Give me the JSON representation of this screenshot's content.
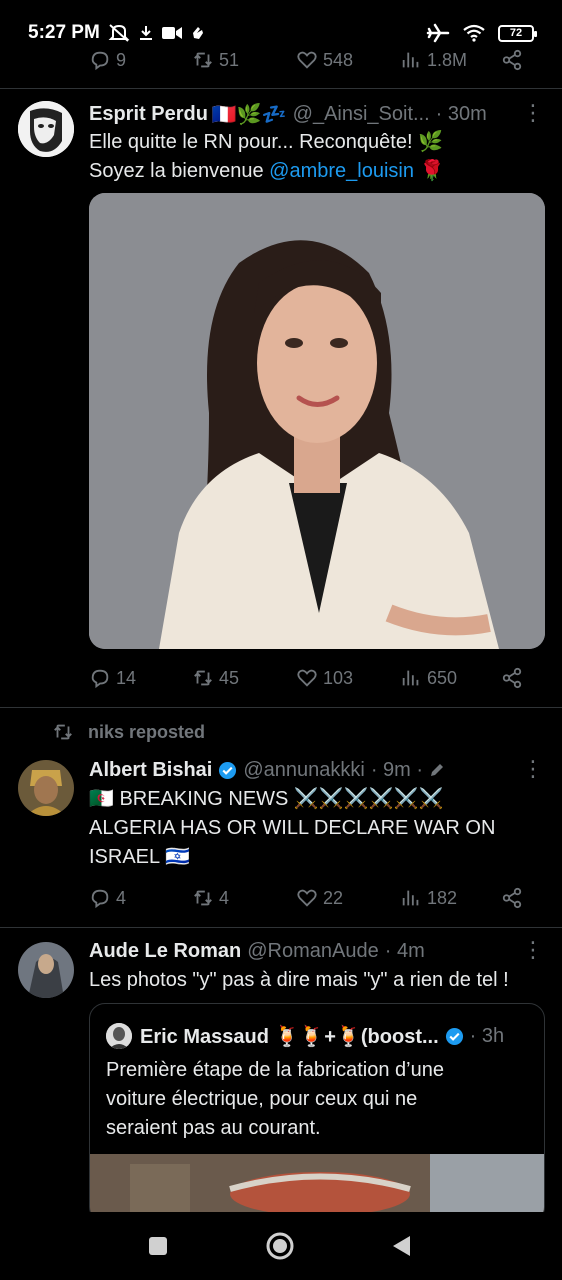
{
  "status_bar": {
    "time": "5:27 PM",
    "battery": "72",
    "icons": [
      "mute-icon",
      "download-icon",
      "video-icon",
      "hand-icon",
      "airplane-icon",
      "wifi-icon",
      "battery-icon"
    ]
  },
  "top_actions": {
    "replies": "9",
    "reposts": "51",
    "likes": "548",
    "views": "1.8M"
  },
  "tweet1": {
    "name": "Esprit Perdu",
    "name_emoji": "🇫🇷🌿💤",
    "handle": "@_Ainsi_Soit...",
    "time": "· 30m",
    "text_line1": "Elle quitte le RN pour... Reconquête! 🌿",
    "text_line2_prefix": "Soyez la bienvenue ",
    "mention": "@ambre_louisin",
    "text_line2_suffix": " 🌹",
    "replies": "14",
    "reposts": "45",
    "likes": "103",
    "views": "650"
  },
  "tweet2": {
    "repost_label": "niks reposted",
    "name": "Albert Bishai",
    "handle": "@annunakkki",
    "time": "· 9m ·",
    "line1": "🇩🇿 BREAKING NEWS ⚔️⚔️⚔️⚔️⚔️⚔️",
    "line2": "ALGERIA HAS OR WILL DECLARE WAR ON",
    "line3": "ISRAEL 🇮🇱",
    "replies": "4",
    "reposts": "4",
    "likes": "22",
    "views": "182"
  },
  "tweet3": {
    "name": "Aude Le Roman",
    "handle": "@RomanAude",
    "time": "· 4m",
    "text": "Les photos \"y\" pas à dire mais \"y\" a rien de tel !",
    "quote": {
      "name": "Eric Massaud 🍹🍹+🍹(boost...",
      "time": "· 3h",
      "line1": "Première étape de la fabrication d’une",
      "line2": "voiture électrique, pour ceux qui ne",
      "line3": "seraient pas au courant."
    }
  },
  "colors": {
    "background": "#000000",
    "text": "#e7e9ea",
    "muted": "#71767b",
    "accent": "#1d9bf0",
    "divider": "#2f3336"
  }
}
